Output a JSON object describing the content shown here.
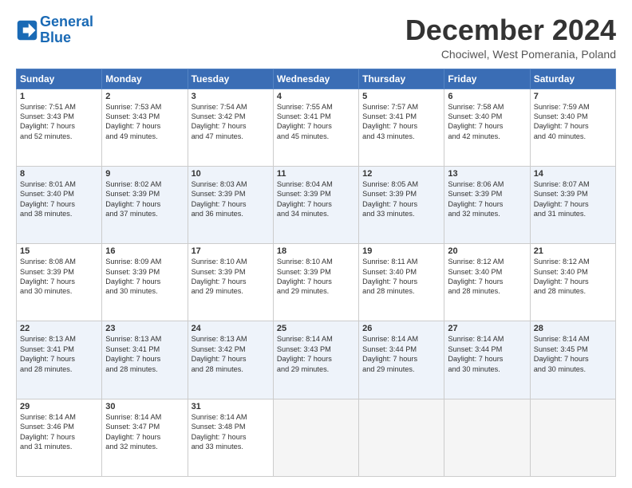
{
  "logo": {
    "line1": "General",
    "line2": "Blue"
  },
  "title": "December 2024",
  "location": "Chociwel, West Pomerania, Poland",
  "days_header": [
    "Sunday",
    "Monday",
    "Tuesday",
    "Wednesday",
    "Thursday",
    "Friday",
    "Saturday"
  ],
  "weeks": [
    [
      {
        "day": "1",
        "lines": [
          "Sunrise: 7:51 AM",
          "Sunset: 3:43 PM",
          "Daylight: 7 hours",
          "and 52 minutes."
        ]
      },
      {
        "day": "2",
        "lines": [
          "Sunrise: 7:53 AM",
          "Sunset: 3:43 PM",
          "Daylight: 7 hours",
          "and 49 minutes."
        ]
      },
      {
        "day": "3",
        "lines": [
          "Sunrise: 7:54 AM",
          "Sunset: 3:42 PM",
          "Daylight: 7 hours",
          "and 47 minutes."
        ]
      },
      {
        "day": "4",
        "lines": [
          "Sunrise: 7:55 AM",
          "Sunset: 3:41 PM",
          "Daylight: 7 hours",
          "and 45 minutes."
        ]
      },
      {
        "day": "5",
        "lines": [
          "Sunrise: 7:57 AM",
          "Sunset: 3:41 PM",
          "Daylight: 7 hours",
          "and 43 minutes."
        ]
      },
      {
        "day": "6",
        "lines": [
          "Sunrise: 7:58 AM",
          "Sunset: 3:40 PM",
          "Daylight: 7 hours",
          "and 42 minutes."
        ]
      },
      {
        "day": "7",
        "lines": [
          "Sunrise: 7:59 AM",
          "Sunset: 3:40 PM",
          "Daylight: 7 hours",
          "and 40 minutes."
        ]
      }
    ],
    [
      {
        "day": "8",
        "lines": [
          "Sunrise: 8:01 AM",
          "Sunset: 3:40 PM",
          "Daylight: 7 hours",
          "and 38 minutes."
        ]
      },
      {
        "day": "9",
        "lines": [
          "Sunrise: 8:02 AM",
          "Sunset: 3:39 PM",
          "Daylight: 7 hours",
          "and 37 minutes."
        ]
      },
      {
        "day": "10",
        "lines": [
          "Sunrise: 8:03 AM",
          "Sunset: 3:39 PM",
          "Daylight: 7 hours",
          "and 36 minutes."
        ]
      },
      {
        "day": "11",
        "lines": [
          "Sunrise: 8:04 AM",
          "Sunset: 3:39 PM",
          "Daylight: 7 hours",
          "and 34 minutes."
        ]
      },
      {
        "day": "12",
        "lines": [
          "Sunrise: 8:05 AM",
          "Sunset: 3:39 PM",
          "Daylight: 7 hours",
          "and 33 minutes."
        ]
      },
      {
        "day": "13",
        "lines": [
          "Sunrise: 8:06 AM",
          "Sunset: 3:39 PM",
          "Daylight: 7 hours",
          "and 32 minutes."
        ]
      },
      {
        "day": "14",
        "lines": [
          "Sunrise: 8:07 AM",
          "Sunset: 3:39 PM",
          "Daylight: 7 hours",
          "and 31 minutes."
        ]
      }
    ],
    [
      {
        "day": "15",
        "lines": [
          "Sunrise: 8:08 AM",
          "Sunset: 3:39 PM",
          "Daylight: 7 hours",
          "and 30 minutes."
        ]
      },
      {
        "day": "16",
        "lines": [
          "Sunrise: 8:09 AM",
          "Sunset: 3:39 PM",
          "Daylight: 7 hours",
          "and 30 minutes."
        ]
      },
      {
        "day": "17",
        "lines": [
          "Sunrise: 8:10 AM",
          "Sunset: 3:39 PM",
          "Daylight: 7 hours",
          "and 29 minutes."
        ]
      },
      {
        "day": "18",
        "lines": [
          "Sunrise: 8:10 AM",
          "Sunset: 3:39 PM",
          "Daylight: 7 hours",
          "and 29 minutes."
        ]
      },
      {
        "day": "19",
        "lines": [
          "Sunrise: 8:11 AM",
          "Sunset: 3:40 PM",
          "Daylight: 7 hours",
          "and 28 minutes."
        ]
      },
      {
        "day": "20",
        "lines": [
          "Sunrise: 8:12 AM",
          "Sunset: 3:40 PM",
          "Daylight: 7 hours",
          "and 28 minutes."
        ]
      },
      {
        "day": "21",
        "lines": [
          "Sunrise: 8:12 AM",
          "Sunset: 3:40 PM",
          "Daylight: 7 hours",
          "and 28 minutes."
        ]
      }
    ],
    [
      {
        "day": "22",
        "lines": [
          "Sunrise: 8:13 AM",
          "Sunset: 3:41 PM",
          "Daylight: 7 hours",
          "and 28 minutes."
        ]
      },
      {
        "day": "23",
        "lines": [
          "Sunrise: 8:13 AM",
          "Sunset: 3:41 PM",
          "Daylight: 7 hours",
          "and 28 minutes."
        ]
      },
      {
        "day": "24",
        "lines": [
          "Sunrise: 8:13 AM",
          "Sunset: 3:42 PM",
          "Daylight: 7 hours",
          "and 28 minutes."
        ]
      },
      {
        "day": "25",
        "lines": [
          "Sunrise: 8:14 AM",
          "Sunset: 3:43 PM",
          "Daylight: 7 hours",
          "and 29 minutes."
        ]
      },
      {
        "day": "26",
        "lines": [
          "Sunrise: 8:14 AM",
          "Sunset: 3:44 PM",
          "Daylight: 7 hours",
          "and 29 minutes."
        ]
      },
      {
        "day": "27",
        "lines": [
          "Sunrise: 8:14 AM",
          "Sunset: 3:44 PM",
          "Daylight: 7 hours",
          "and 30 minutes."
        ]
      },
      {
        "day": "28",
        "lines": [
          "Sunrise: 8:14 AM",
          "Sunset: 3:45 PM",
          "Daylight: 7 hours",
          "and 30 minutes."
        ]
      }
    ],
    [
      {
        "day": "29",
        "lines": [
          "Sunrise: 8:14 AM",
          "Sunset: 3:46 PM",
          "Daylight: 7 hours",
          "and 31 minutes."
        ]
      },
      {
        "day": "30",
        "lines": [
          "Sunrise: 8:14 AM",
          "Sunset: 3:47 PM",
          "Daylight: 7 hours",
          "and 32 minutes."
        ]
      },
      {
        "day": "31",
        "lines": [
          "Sunrise: 8:14 AM",
          "Sunset: 3:48 PM",
          "Daylight: 7 hours",
          "and 33 minutes."
        ]
      },
      null,
      null,
      null,
      null
    ]
  ]
}
